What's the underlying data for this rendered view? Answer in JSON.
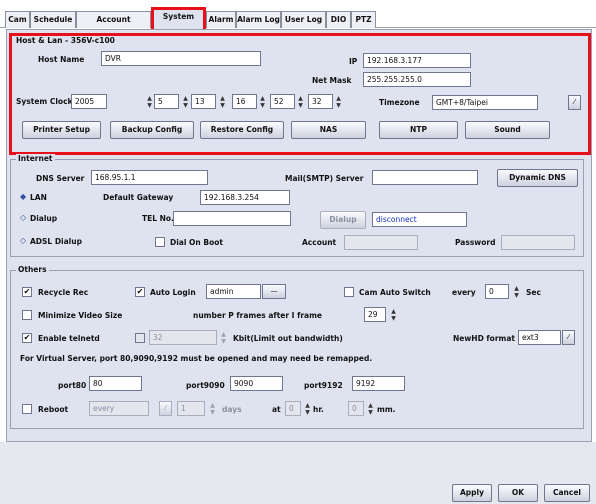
{
  "tabs": [
    "Cam",
    "Schedule",
    "Account",
    "System",
    "Alarm",
    "Alarm Log",
    "User Log",
    "DIO",
    "PTZ"
  ],
  "host_lan": {
    "group_label": "Host & Lan - 356V-c100",
    "host_name_label": "Host Name",
    "host_name": "DVR",
    "ip_label": "IP",
    "ip": "192.168.3.177",
    "netmask_label": "Net Mask",
    "netmask": "255.255.255.0",
    "system_clock_label": "System Clock",
    "year": "2005",
    "month": "5",
    "day": "13",
    "hour": "16",
    "minute": "52",
    "second": "32",
    "timezone_label": "Timezone",
    "timezone": "GMT+8/Taipei",
    "buttons": [
      "Printer Setup",
      "Backup Config",
      "Restore Config",
      "NAS",
      "NTP",
      "Sound"
    ]
  },
  "internet": {
    "group_label": "Internet",
    "dns_label": "DNS Server",
    "dns": "168.95.1.1",
    "smtp_label": "Mail(SMTP) Server",
    "smtp": "",
    "dynamic_dns": "Dynamic DNS",
    "lan_label": "LAN",
    "gateway_label": "Default Gateway",
    "gateway": "192.168.3.254",
    "dialup_label": "Dialup",
    "tel_label": "TEL No.",
    "tel": "",
    "dialup_btn": "Dialup",
    "disconnect": "disconnect",
    "adsl_label": "ADSL Dialup",
    "dial_on_boot": "Dial On Boot",
    "account_label": "Account",
    "account": "",
    "password_label": "Password",
    "password": ""
  },
  "others": {
    "group_label": "Others",
    "recycle": "Recycle Rec",
    "auto_login": "Auto Login",
    "auto_login_user": "admin",
    "cam_auto_switch": "Cam Auto Switch",
    "every_label": "every",
    "every_value": "0",
    "sec": "Sec",
    "minimize": "Minimize Video Size",
    "pframes_label": "number P frames after I frame",
    "pframes": "29",
    "telnetd": "Enable telnetd",
    "kbit_value": "32",
    "kbit_label": "Kbit(Limit out bandwidth)",
    "newhd_label": "NewHD format",
    "newhd": "ext3",
    "virtual_note": "For Virtual Server, port 80,9090,9192 must be opened and may need be remapped.",
    "port80_label": "port80",
    "port80": "80",
    "port9090_label": "port9090",
    "port9090": "9090",
    "port9192_label": "port9192",
    "port9192": "9192",
    "reboot": "Reboot",
    "reboot_freq": "every",
    "reboot_days_value": "1",
    "days": "days",
    "at_label": "at",
    "hr_value": "0",
    "hr": "hr.",
    "min_value": "0",
    "mm": "mm."
  },
  "footer": {
    "apply": "Apply",
    "ok": "OK",
    "cancel": "Cancel"
  }
}
